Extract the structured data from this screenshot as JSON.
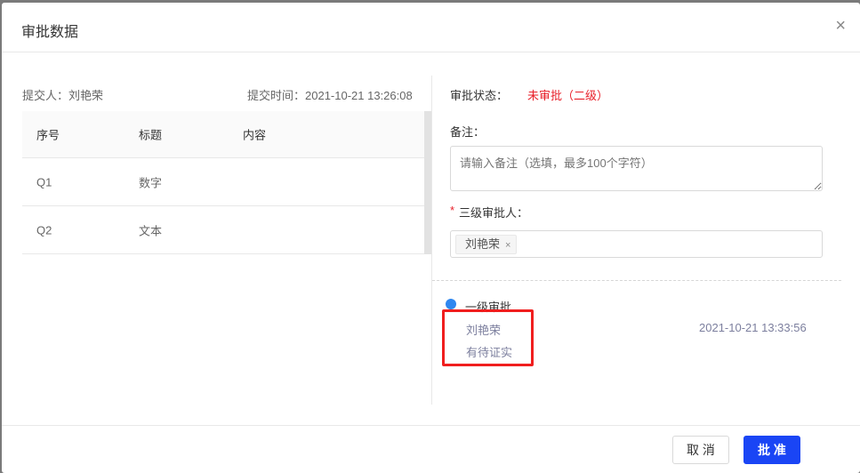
{
  "modal": {
    "title": "审批数据",
    "close_icon": "×"
  },
  "left": {
    "submitter": "提交人：刘艳荣",
    "submit_time": "提交时间：2021-10-21 13:26:08",
    "table": {
      "headers": [
        "序号",
        "标题",
        "内容"
      ],
      "rows": [
        [
          "Q1",
          "数字",
          ""
        ],
        [
          "Q2",
          "文本",
          ""
        ]
      ]
    }
  },
  "right": {
    "status_label": "审批状态：",
    "status_value": "未审批（二级）",
    "status_color": "#e8202a",
    "remark_label": "备注：",
    "remark_placeholder": "请输入备注（选填，最多100个字符）",
    "remark_value": "",
    "approver_required": "*",
    "approver_label": "三级审批人：",
    "approver_tag": "刘艳荣",
    "tag_remove": "×",
    "timeline": [
      {
        "title": "一级审批",
        "person": "刘艳荣",
        "comment": "有待证实",
        "time": "2021-10-21 13:33:56"
      }
    ]
  },
  "footer": {
    "cancel": "取 消",
    "approve": "批 准"
  }
}
